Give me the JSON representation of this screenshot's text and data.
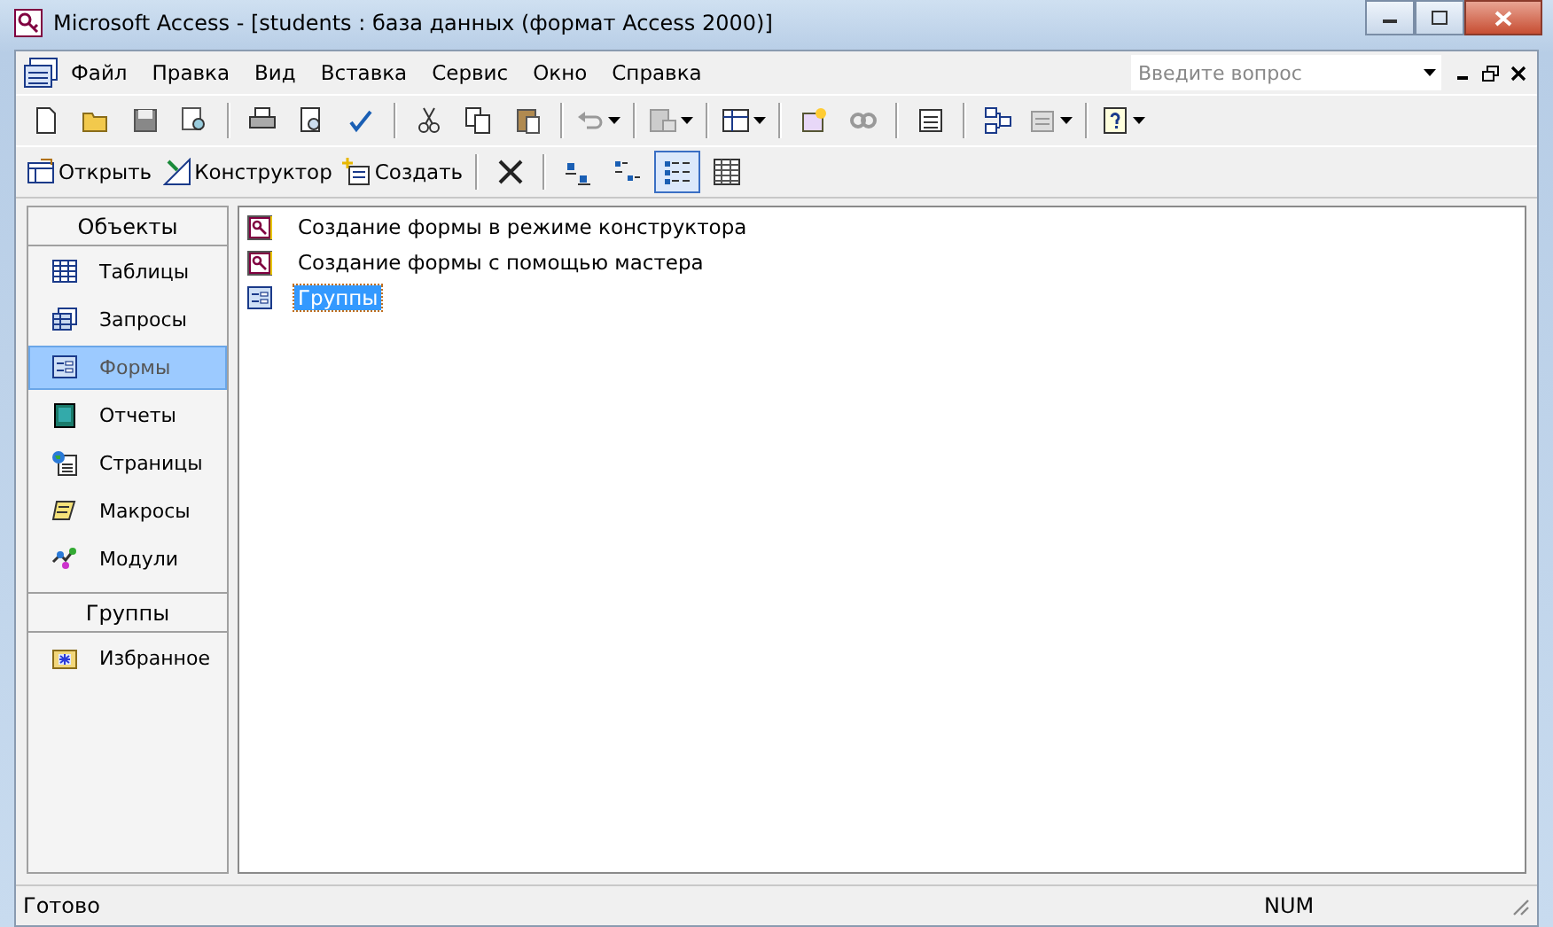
{
  "window": {
    "title": "Microsoft Access - [students : база данных (формат Access 2000)]"
  },
  "menu": [
    "Файл",
    "Правка",
    "Вид",
    "Вставка",
    "Сервис",
    "Окно",
    "Справка"
  ],
  "help_field": {
    "placeholder": "Введите вопрос"
  },
  "db_toolbar": {
    "buttons": [
      "Открыть",
      "Конструктор",
      "Создать"
    ],
    "view_buttons": [
      {
        "selected": false
      },
      {
        "selected": false
      },
      {
        "selected": true
      },
      {
        "selected": false
      }
    ]
  },
  "sidebar": {
    "sections": [
      {
        "header": "Объекты",
        "items": [
          {
            "label": "Таблицы",
            "kind": "table",
            "selected": false
          },
          {
            "label": "Запросы",
            "kind": "query",
            "selected": false
          },
          {
            "label": "Формы",
            "kind": "form",
            "selected": true
          },
          {
            "label": "Отчеты",
            "kind": "report",
            "selected": false
          },
          {
            "label": "Страницы",
            "kind": "page",
            "selected": false
          },
          {
            "label": "Макросы",
            "kind": "macro",
            "selected": false
          },
          {
            "label": "Модули",
            "kind": "module",
            "selected": false
          }
        ]
      },
      {
        "header": "Группы",
        "items": [
          {
            "label": "Избранное",
            "kind": "favorites",
            "selected": false
          }
        ]
      }
    ]
  },
  "objects": [
    {
      "label": "Создание формы в режиме конструктора",
      "kind": "shortcut",
      "selected": false
    },
    {
      "label": "Создание формы с помощью мастера",
      "kind": "shortcut",
      "selected": false
    },
    {
      "label": "Группы",
      "kind": "form",
      "selected": true
    }
  ],
  "status_bar": {
    "message": "Готово",
    "indicator": "NUM"
  }
}
